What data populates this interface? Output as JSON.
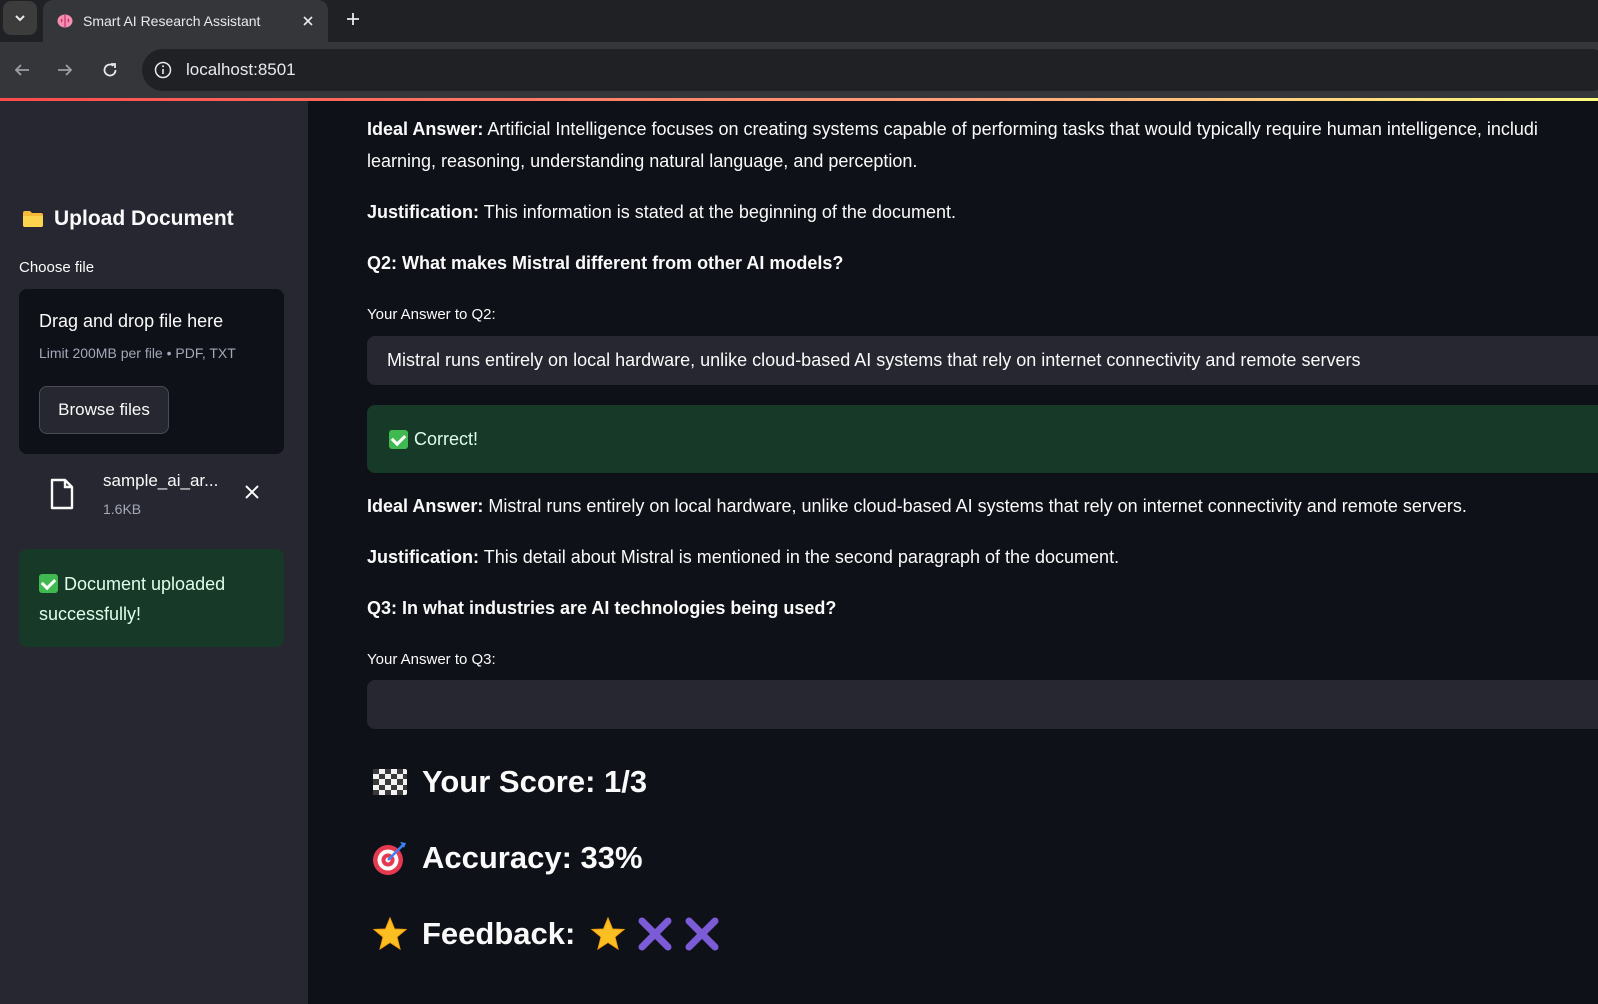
{
  "browser": {
    "tab_title": "Smart AI Research Assistant",
    "url": "localhost:8501"
  },
  "sidebar": {
    "heading": "Upload Document",
    "choose_label": "Choose file",
    "dropzone_title": "Drag and drop file here",
    "dropzone_limit": "Limit 200MB per file • PDF, TXT",
    "browse_label": "Browse files",
    "file_name": "sample_ai_ar...",
    "file_size": "1.6KB",
    "success_message": "Document uploaded successfully!"
  },
  "main": {
    "q1_ideal_label": "Ideal Answer:",
    "q1_ideal_line1": "Artificial Intelligence focuses on creating systems capable of performing tasks that would typically require human intelligence, includi",
    "q1_ideal_line2": "learning, reasoning, understanding natural language, and perception.",
    "q1_justification_label": "Justification:",
    "q1_justification": "This information is stated at the beginning of the document.",
    "q2_question": "Q2: What makes Mistral different from other AI models?",
    "q2_input_label": "Your Answer to Q2:",
    "q2_answer": "Mistral runs entirely on local hardware, unlike cloud-based AI systems that rely on internet connectivity and remote servers",
    "q2_result": "Correct!",
    "q2_ideal_label": "Ideal Answer:",
    "q2_ideal": "Mistral runs entirely on local hardware, unlike cloud-based AI systems that rely on internet connectivity and remote servers.",
    "q2_justification_label": "Justification:",
    "q2_justification": "This detail about Mistral is mentioned in the second paragraph of the document.",
    "q3_question": "Q3: In what industries are AI technologies being used?",
    "q3_input_label": "Your Answer to Q3:",
    "q3_answer": "",
    "score_text": "Your Score: 1/3",
    "accuracy_text": "Accuracy: 33%",
    "feedback_text": "Feedback:",
    "feedback_icons": [
      "star-icon",
      "cross-mark-icon",
      "cross-mark-icon"
    ]
  },
  "colors": {
    "background": "#0e1117",
    "sidebar": "#262730",
    "success_bg": "#173928",
    "accent_red": "#ff4b4b"
  }
}
